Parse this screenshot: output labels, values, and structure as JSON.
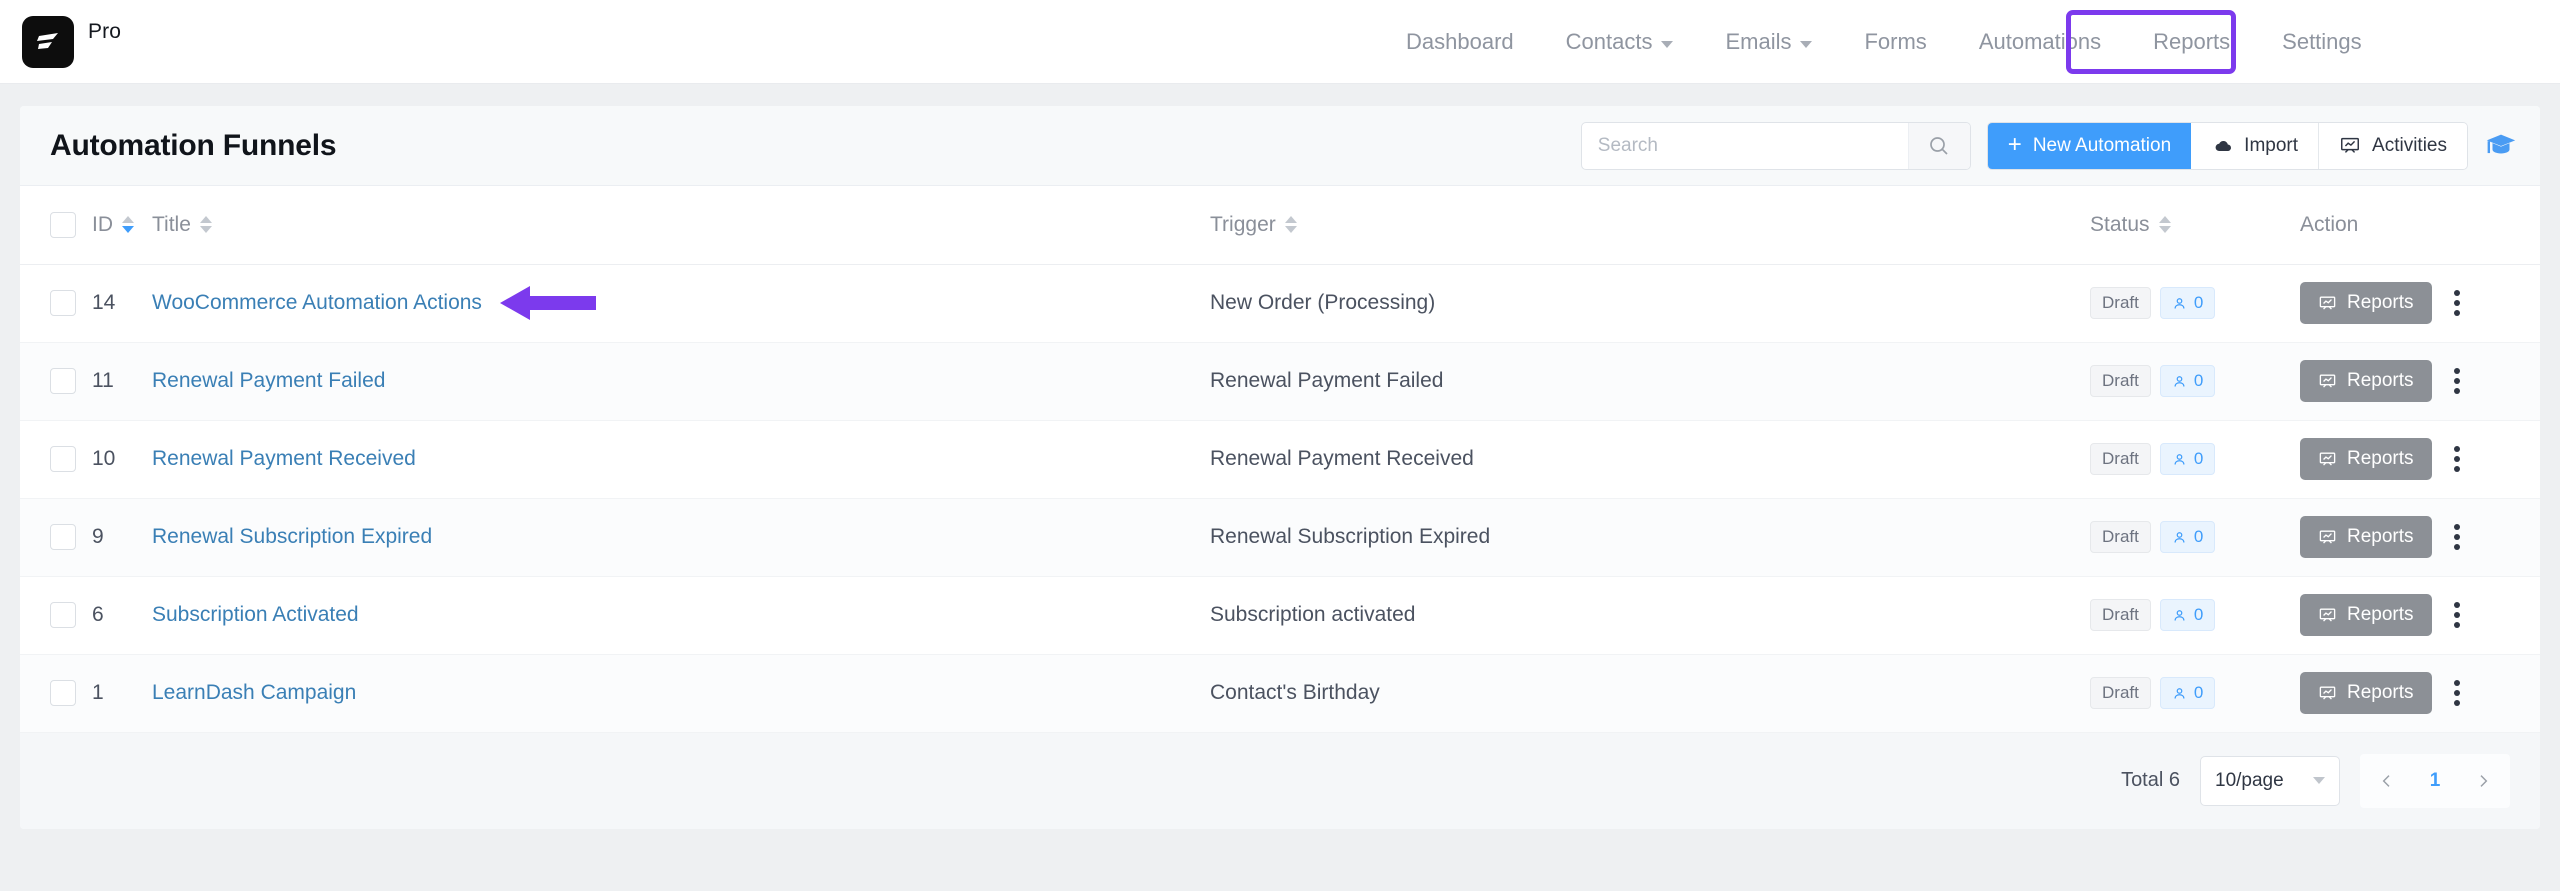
{
  "brand": {
    "logo_icon": "fluentcrm-logo-icon",
    "edition_label": "Pro"
  },
  "nav": {
    "items": [
      {
        "label": "Dashboard",
        "has_caret": false,
        "active": false
      },
      {
        "label": "Contacts",
        "has_caret": true,
        "active": false
      },
      {
        "label": "Emails",
        "has_caret": true,
        "active": false
      },
      {
        "label": "Forms",
        "has_caret": false,
        "active": false
      },
      {
        "label": "Automations",
        "has_caret": false,
        "active": true
      },
      {
        "label": "Reports",
        "has_caret": false,
        "active": false
      },
      {
        "label": "Settings",
        "has_caret": false,
        "active": false
      }
    ],
    "highlight_color": "#7c3aed"
  },
  "header": {
    "title": "Automation Funnels"
  },
  "toolbar": {
    "search_placeholder": "Search",
    "search_value": "",
    "search_icon": "search-icon",
    "new_automation_label": "New Automation",
    "new_automation_plus": "+",
    "import_label": "Import",
    "import_icon": "cloud-upload-icon",
    "activities_label": "Activities",
    "activities_icon": "presentation-chart-icon",
    "help_icon": "graduation-cap-icon",
    "primary_color": "#3f9dfb"
  },
  "table": {
    "columns": [
      {
        "label": "ID",
        "sortable": true,
        "sort": "desc"
      },
      {
        "label": "Title",
        "sortable": true,
        "sort": "none"
      },
      {
        "label": "Trigger",
        "sortable": true,
        "sort": "none"
      },
      {
        "label": "Status",
        "sortable": true,
        "sort": "none"
      },
      {
        "label": "Action",
        "sortable": false,
        "sort": "none"
      }
    ],
    "rows": [
      {
        "id": "14",
        "title": "WooCommerce Automation Actions",
        "trigger": "New Order (Processing)",
        "status": "Draft",
        "contacts": "0",
        "reports_label": "Reports",
        "annotated": true
      },
      {
        "id": "11",
        "title": "Renewal Payment Failed",
        "trigger": "Renewal Payment Failed",
        "status": "Draft",
        "contacts": "0",
        "reports_label": "Reports",
        "annotated": false
      },
      {
        "id": "10",
        "title": "Renewal Payment Received",
        "trigger": "Renewal Payment Received",
        "status": "Draft",
        "contacts": "0",
        "reports_label": "Reports",
        "annotated": false
      },
      {
        "id": "9",
        "title": "Renewal Subscription Expired",
        "trigger": "Renewal Subscription Expired",
        "status": "Draft",
        "contacts": "0",
        "reports_label": "Reports",
        "annotated": false
      },
      {
        "id": "6",
        "title": "Subscription Activated",
        "trigger": "Subscription activated",
        "status": "Draft",
        "contacts": "0",
        "reports_label": "Reports",
        "annotated": false
      },
      {
        "id": "1",
        "title": "LearnDash Campaign",
        "trigger": "Contact's Birthday",
        "status": "Draft",
        "contacts": "0",
        "reports_label": "Reports",
        "annotated": false
      }
    ]
  },
  "footer": {
    "total_label": "Total 6",
    "page_size": "10/page",
    "prev_icon": "chevron-left-icon",
    "next_icon": "chevron-right-icon",
    "current_page": "1"
  },
  "annotation": {
    "type": "arrow-left",
    "color": "#7c3aed"
  }
}
